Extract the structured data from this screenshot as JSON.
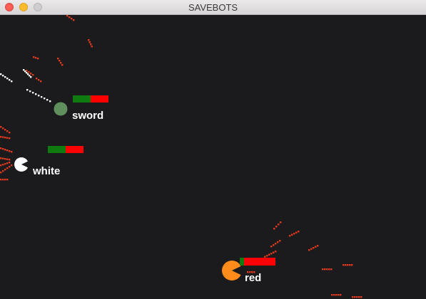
{
  "window": {
    "title": "SAVEBOTS"
  },
  "bots": [
    {
      "name": "sword",
      "color": "#5f8f5c",
      "health": 0.5,
      "health_color": "#0f7a0f",
      "damage_color": "#ff0000"
    },
    {
      "name": "white",
      "color": "#ffffff",
      "health": 0.5,
      "health_color": "#0f7a0f",
      "damage_color": "#ff0000"
    },
    {
      "name": "red",
      "color": "#ff8c1a",
      "health": 0.12,
      "health_color": "#0f7a0f",
      "damage_color": "#ff0000"
    }
  ],
  "projectile_colors": {
    "enemy": "#e0391c",
    "player": "#ffffff"
  }
}
